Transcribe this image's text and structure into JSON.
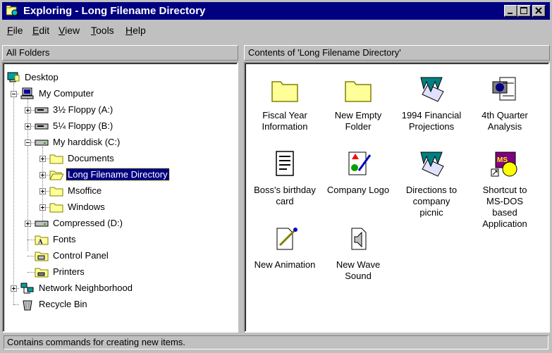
{
  "window": {
    "title": "Exploring - Long Filename Directory"
  },
  "menu": [
    {
      "accel": "F",
      "rest": "ile"
    },
    {
      "accel": "E",
      "rest": "dit"
    },
    {
      "accel": "V",
      "rest": "iew"
    },
    {
      "accel": "T",
      "rest": "ools"
    },
    {
      "accel": "H",
      "rest": "elp"
    }
  ],
  "left_header": "All Folders",
  "right_header": "Contents of 'Long Filename Directory'",
  "tree": [
    {
      "label": "Desktop",
      "icon": "desktop-icon"
    },
    {
      "label": "My Computer",
      "icon": "computer-icon"
    },
    {
      "label": "3½ Floppy (A:)",
      "icon": "floppy-drive-icon"
    },
    {
      "label": "5¼ Floppy (B:)",
      "icon": "floppy-drive-icon"
    },
    {
      "label": "My harddisk (C:)",
      "icon": "hard-drive-icon"
    },
    {
      "label": "Documents",
      "icon": "folder-icon"
    },
    {
      "label": "Long Filename Directory",
      "icon": "open-folder-icon"
    },
    {
      "label": "Msoffice",
      "icon": "folder-icon"
    },
    {
      "label": "Windows",
      "icon": "folder-icon"
    },
    {
      "label": "Compressed (D:)",
      "icon": "hard-drive-icon"
    },
    {
      "label": "Fonts",
      "icon": "fonts-folder-icon"
    },
    {
      "label": "Control Panel",
      "icon": "control-panel-icon"
    },
    {
      "label": "Printers",
      "icon": "printers-folder-icon"
    },
    {
      "label": "Network Neighborhood",
      "icon": "network-icon"
    },
    {
      "label": "Recycle Bin",
      "icon": "recycle-bin-icon"
    }
  ],
  "files": [
    {
      "lines": [
        "Fiscal Year",
        "Information"
      ],
      "icon": "folder-icon"
    },
    {
      "lines": [
        "New Empty",
        "Folder"
      ],
      "icon": "folder-icon"
    },
    {
      "lines": [
        "1994 Financial",
        "Projections"
      ],
      "icon": "worksheet-icon"
    },
    {
      "lines": [
        "4th Quarter",
        "Analysis"
      ],
      "icon": "presentation-icon"
    },
    {
      "lines": [
        "Boss's birthday",
        "card"
      ],
      "icon": "document-icon"
    },
    {
      "lines": [
        "Company Logo",
        ""
      ],
      "icon": "paint-icon"
    },
    {
      "lines": [
        "Directions to",
        "company",
        "picnic"
      ],
      "icon": "worksheet-icon"
    },
    {
      "lines": [
        "Shortcut to",
        "MS-DOS",
        "based",
        "Application"
      ],
      "icon": "msdos-shortcut-icon"
    },
    {
      "lines": [
        "New Animation",
        ""
      ],
      "icon": "animation-icon"
    },
    {
      "lines": [
        "New Wave",
        "Sound"
      ],
      "icon": "wave-sound-icon"
    }
  ],
  "status": "Contains commands for creating new items.",
  "colors": {
    "titlebar": "#000080",
    "face": "#c0c0c0",
    "folder": "#ffff99",
    "selection": "#000080"
  }
}
